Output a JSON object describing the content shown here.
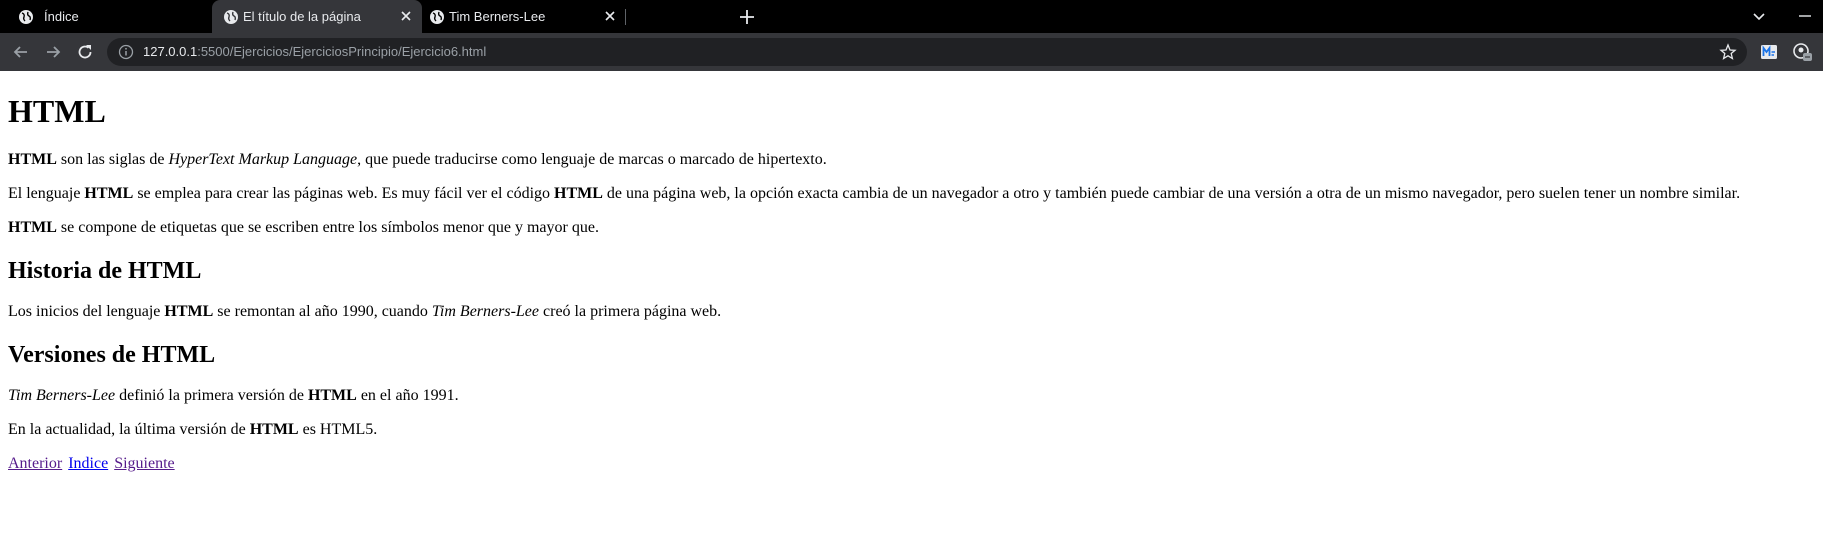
{
  "tabs": [
    {
      "title": "Índice",
      "active": false
    },
    {
      "title": "El título de la página",
      "active": true
    },
    {
      "title": "Tim Berners-Lee",
      "active": false
    }
  ],
  "toolbar": {
    "url_host": "127.0.0.1",
    "url_rest": ":5500/Ejercicios/EjerciciosPrincipio/Ejercicio6.html"
  },
  "page": {
    "h1": "HTML",
    "p1": {
      "b1": "HTML",
      "t1": " son las siglas de ",
      "i1": "HyperText Markup Language",
      "t2": ", que puede traducirse como lenguaje de marcas o marcado de hipertexto."
    },
    "p2": {
      "t1": "El lenguaje ",
      "b1": "HTML",
      "t2": " se emplea para crear las páginas web. Es muy fácil ver el código ",
      "b2": "HTML",
      "t3": " de una página web, la opción exacta cambia de un navegador a otro y también puede cambiar de una versión a otra de un mismo navegador, pero suelen tener un nombre similar."
    },
    "p3": {
      "b1": "HTML",
      "t1": " se compone de etiquetas que se escriben entre los símbolos menor que y mayor que."
    },
    "h2_history": "Historia de HTML",
    "p4": {
      "t1": "Los inicios del lenguaje ",
      "b1": "HTML",
      "t2": " se remontan al año 1990, cuando ",
      "i1": "Tim Berners-Lee",
      "t3": " creó la primera página web."
    },
    "h2_versions": "Versiones de HTML",
    "p5": {
      "i1": "Tim Berners-Lee",
      "t1": " definió la primera versión de ",
      "b1": "HTML",
      "t2": " en el año 1991."
    },
    "p6": {
      "t1": "En la actualidad, la última versión de ",
      "b1": "HTML",
      "t2": " es HTML5."
    },
    "links": {
      "prev": "Anterior",
      "index": "Indice",
      "next": "Siguiente"
    }
  },
  "colors": {
    "tabstrip": "#000000",
    "toolbar": "#35363a",
    "omnibox": "#202124",
    "link": "#0000ee",
    "visited": "#551a8b"
  }
}
